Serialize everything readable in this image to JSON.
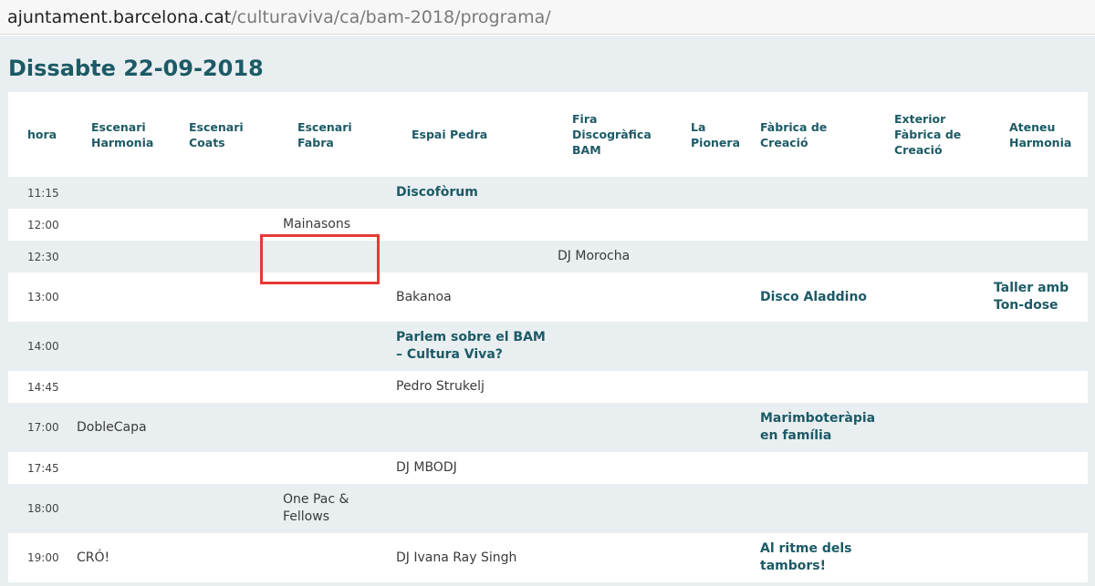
{
  "browser": {
    "url_domain": "ajuntament.barcelona.cat",
    "url_path": "/culturaviva/ca/bam-2018/programa/"
  },
  "page": {
    "day_title": "Dissabte 22-09-2018"
  },
  "table": {
    "headers": [
      [
        "hora"
      ],
      [
        "Escenari",
        "Harmonia"
      ],
      [
        "Escenari",
        "Coats"
      ],
      [
        "Escenari",
        "Fabra"
      ],
      [
        "Espai Pedra"
      ],
      [
        "Fira",
        "Discogràfica",
        "BAM"
      ],
      [
        "La",
        "Pionera"
      ],
      [
        "Fàbrica de",
        "Creació"
      ],
      [
        "Exterior",
        "Fàbrica de",
        "Creació"
      ],
      [
        "Ateneu",
        "Harmonia"
      ]
    ],
    "rows": [
      {
        "time": "11:15",
        "events": [
          {
            "col": 4,
            "lines": [
              "Discofòrum"
            ],
            "bold": true
          }
        ]
      },
      {
        "time": "12:00",
        "events": [
          {
            "col": 3,
            "lines": [
              "Mainasons"
            ],
            "bold": false
          }
        ]
      },
      {
        "time": "12:30",
        "events": [
          {
            "col": 5,
            "lines": [
              "DJ Morocha"
            ],
            "bold": false
          }
        ]
      },
      {
        "time": "13:00",
        "events": [
          {
            "col": 4,
            "lines": [
              "Bakanoa"
            ],
            "bold": false
          },
          {
            "col": 7,
            "lines": [
              "Disco Aladdino"
            ],
            "bold": true
          },
          {
            "col": 9,
            "lines": [
              "Taller amb",
              "Ton-dose"
            ],
            "bold": true
          }
        ]
      },
      {
        "time": "14:00",
        "events": [
          {
            "col": 4,
            "lines": [
              "Parlem sobre el BAM",
              "– Cultura Viva?"
            ],
            "bold": true
          }
        ]
      },
      {
        "time": "14:45",
        "events": [
          {
            "col": 4,
            "lines": [
              "Pedro Strukelj"
            ],
            "bold": false
          }
        ]
      },
      {
        "time": "17:00",
        "events": [
          {
            "col": 1,
            "lines": [
              "DobleCapa"
            ],
            "bold": false
          },
          {
            "col": 7,
            "lines": [
              "Marimboteràpia",
              "en família"
            ],
            "bold": true
          }
        ]
      },
      {
        "time": "17:45",
        "events": [
          {
            "col": 4,
            "lines": [
              "DJ MBODJ"
            ],
            "bold": false
          }
        ]
      },
      {
        "time": "18:00",
        "events": [
          {
            "col": 3,
            "lines": [
              "One Pac &",
              "Fellows"
            ],
            "bold": false
          }
        ]
      },
      {
        "time": "19:00",
        "events": [
          {
            "col": 1,
            "lines": [
              "CRÓ!"
            ],
            "bold": false
          },
          {
            "col": 4,
            "lines": [
              "DJ Ivana Ray Singh"
            ],
            "bold": false
          },
          {
            "col": 7,
            "lines": [
              "Al ritme dels",
              "tambors!"
            ],
            "bold": true
          }
        ]
      }
    ]
  },
  "annotation": {
    "highlight_color": "#e53935",
    "highlighted_item": "Mainasons"
  }
}
